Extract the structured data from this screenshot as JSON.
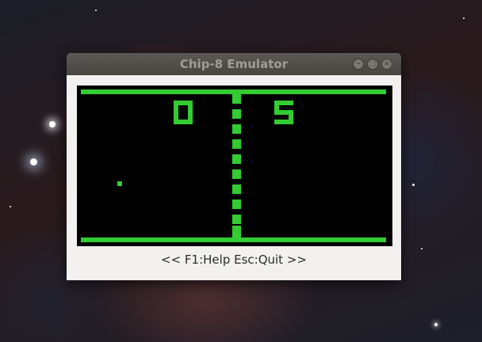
{
  "window": {
    "title": "Chip-8 Emulator",
    "controls": {
      "minimize": "−",
      "maximize": "□",
      "close": "×"
    }
  },
  "game": {
    "name": "pong",
    "score_left": "0",
    "score_right": "5",
    "foreground_color": "#33cc33",
    "background_color": "#000000"
  },
  "status_bar": {
    "text": "<< F1:Help Esc:Quit >>"
  }
}
